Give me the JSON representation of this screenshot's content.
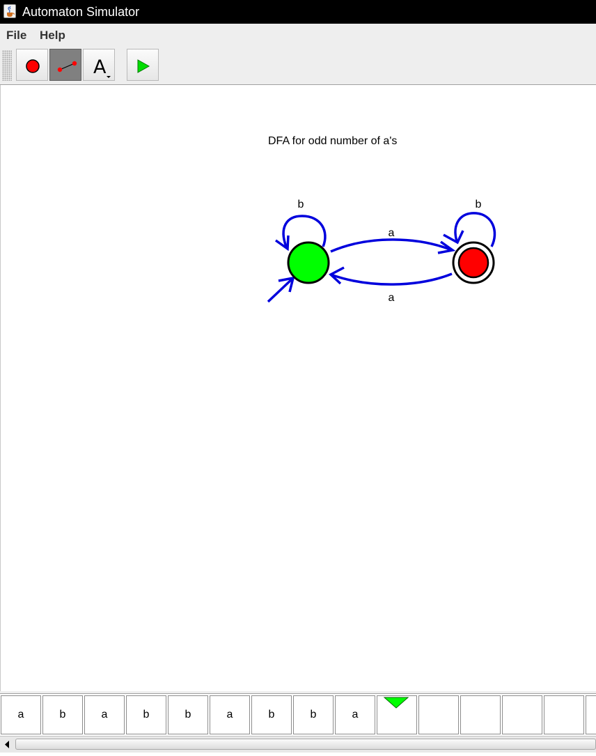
{
  "window": {
    "title": "Automaton Simulator"
  },
  "menu": {
    "items": [
      "File",
      "Help"
    ]
  },
  "toolbar": {
    "buttons": [
      {
        "name": "state-tool",
        "icon": "red-circle-icon",
        "selected": false
      },
      {
        "name": "transition-tool",
        "icon": "edge-tool-icon",
        "selected": true
      },
      {
        "name": "label-tool",
        "icon": "letter-a-dropdown-icon",
        "label": "A",
        "selected": false
      },
      {
        "name": "run-button",
        "icon": "play-icon",
        "selected": false
      }
    ]
  },
  "diagram": {
    "title": "DFA for odd number of a's",
    "states": [
      {
        "id": "q0",
        "start": true,
        "accepting": false,
        "color": "#00ff00"
      },
      {
        "id": "q1",
        "start": false,
        "accepting": true,
        "color": "#ff0000"
      }
    ],
    "transitions": [
      {
        "from": "q0",
        "to": "q0",
        "label": "b"
      },
      {
        "from": "q1",
        "to": "q1",
        "label": "b"
      },
      {
        "from": "q0",
        "to": "q1",
        "label": "a"
      },
      {
        "from": "q1",
        "to": "q0",
        "label": "a"
      }
    ],
    "edge_color": "#0000dd"
  },
  "tape": {
    "cells": [
      "a",
      "b",
      "a",
      "b",
      "b",
      "a",
      "b",
      "b",
      "a",
      "",
      "",
      "",
      "",
      "",
      ""
    ],
    "head_index": 9,
    "head_color": "#00ff00"
  }
}
